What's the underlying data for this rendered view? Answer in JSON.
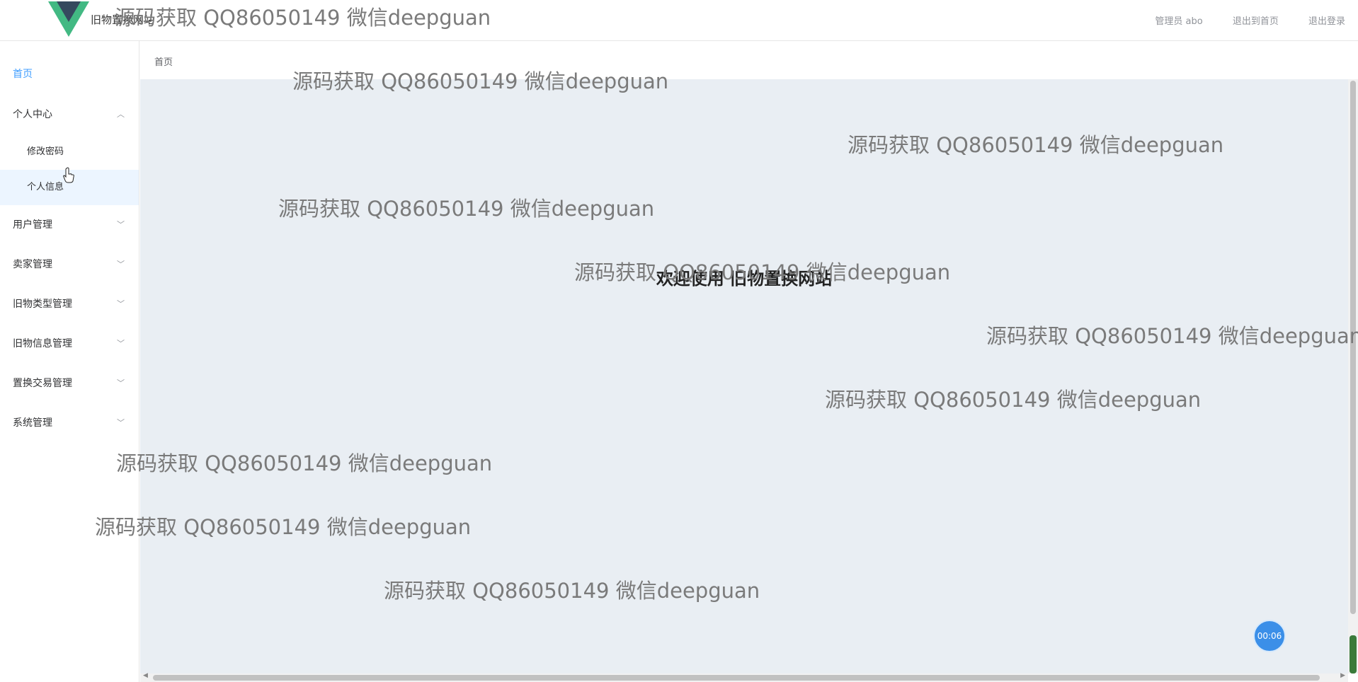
{
  "header": {
    "site_title": "旧物置换网站",
    "admin_label": "管理员 abo",
    "back_home_link": "退出到首页",
    "logout_link": "退出登录",
    "logo_color": "#42b983"
  },
  "sidebar": {
    "home": "首页",
    "personal_center": "个人中心",
    "change_password": "修改密码",
    "personal_info": "个人信息",
    "user_mgmt": "用户管理",
    "seller_mgmt": "卖家管理",
    "item_type_mgmt": "旧物类型管理",
    "item_info_mgmt": "旧物信息管理",
    "exchange_mgmt": "置换交易管理",
    "system_mgmt": "系统管理",
    "active_color": "#409EFF"
  },
  "breadcrumb": {
    "current": "首页"
  },
  "main": {
    "welcome_text": "欢迎使用 旧物置换网站"
  },
  "timer": {
    "value": "00:06"
  },
  "watermark": {
    "text": "源码获取 QQ86050149 微信deepguan"
  }
}
